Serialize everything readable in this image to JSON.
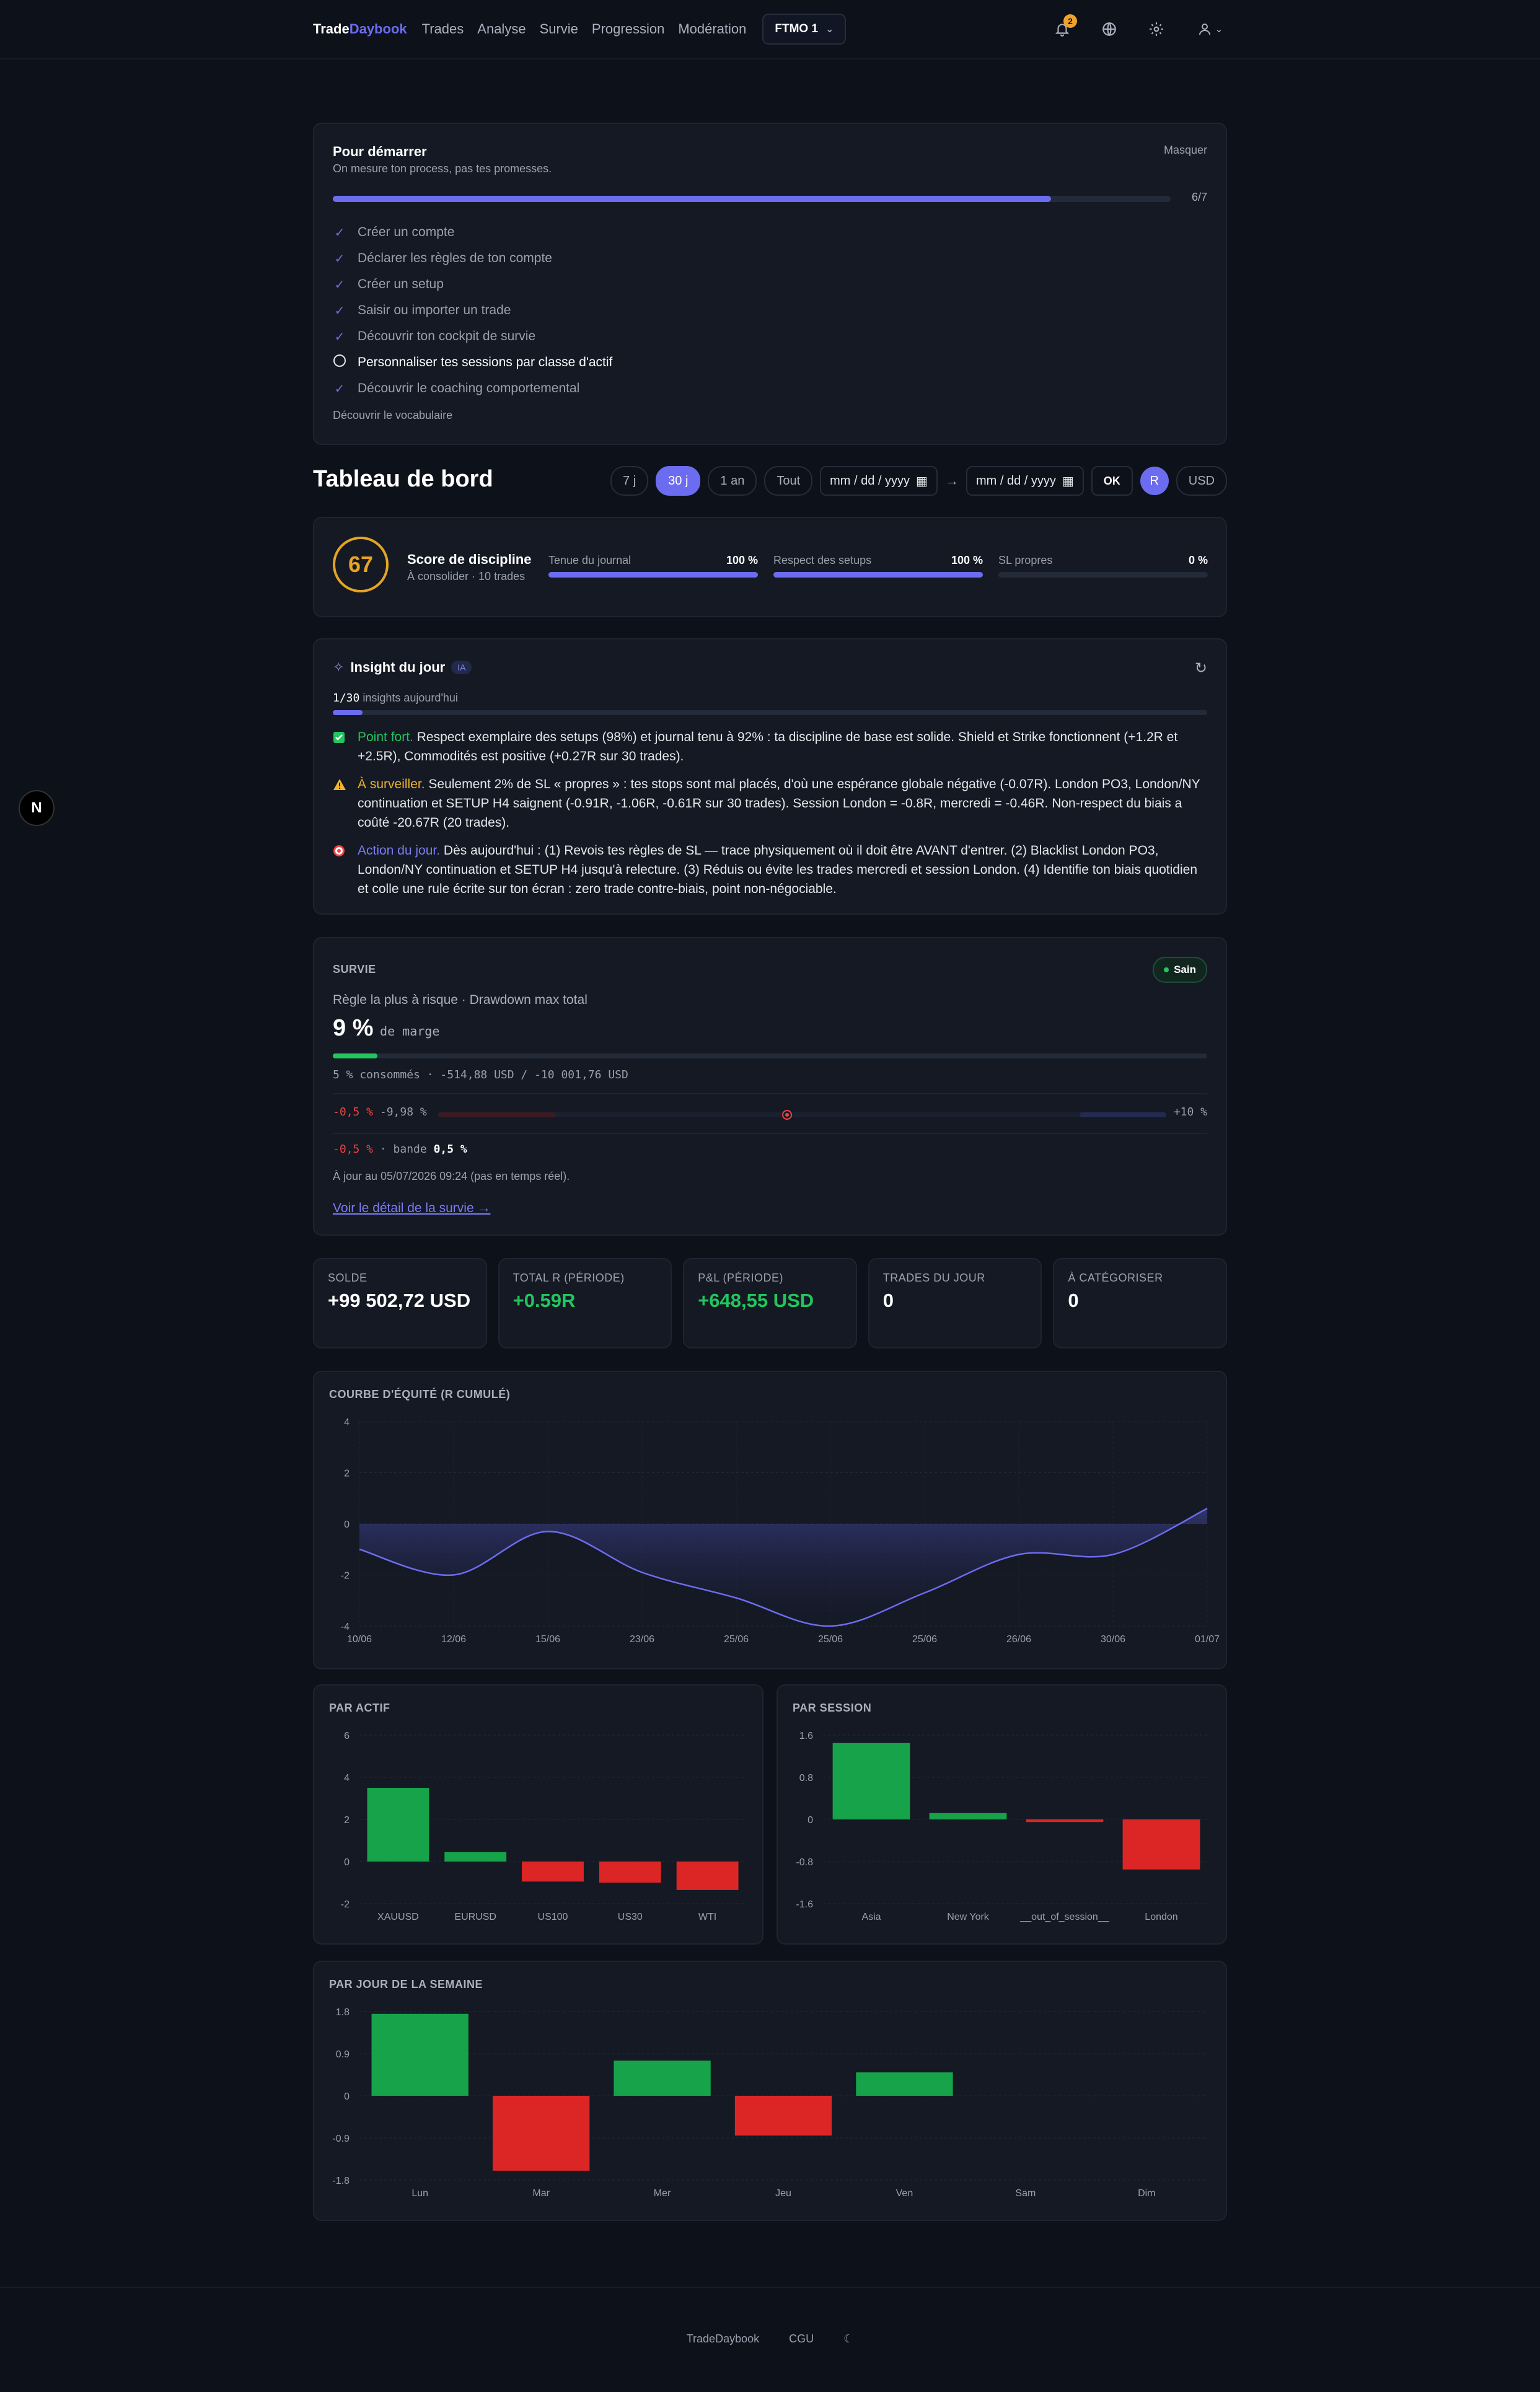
{
  "nav": {
    "brand_a": "Trade",
    "brand_b": "Daybook",
    "links": [
      "Trades",
      "Analyse",
      "Survie",
      "Progression",
      "Modération"
    ],
    "account": "FTMO 1",
    "notif_count": "2"
  },
  "onboarding": {
    "title": "Pour démarrer",
    "subtitle": "On mesure ton process, pas tes promesses.",
    "hide": "Masquer",
    "progress_text": "6/7",
    "progress": 0.857,
    "items": [
      {
        "label": "Créer un compte",
        "done": true
      },
      {
        "label": "Déclarer les règles de ton compte",
        "done": true
      },
      {
        "label": "Créer un setup",
        "done": true
      },
      {
        "label": "Saisir ou importer un trade",
        "done": true
      },
      {
        "label": "Découvrir ton cockpit de survie",
        "done": true
      },
      {
        "label": "Personnaliser tes sessions par classe d'actif",
        "done": false
      },
      {
        "label": "Découvrir le coaching comportemental",
        "done": true
      }
    ],
    "vocab_link": "Découvrir le vocabulaire"
  },
  "dashboard": {
    "title": "Tableau de bord",
    "periods": [
      "7 j",
      "30 j",
      "1 an",
      "Tout"
    ],
    "active_period": "30 j",
    "date_placeholder": "mm / dd / yyyy",
    "arrow": "→",
    "ok": "OK",
    "unit_r": "R",
    "unit_usd": "USD"
  },
  "discipline": {
    "score": "67",
    "title": "Score de discipline",
    "subtitle": "À consolider · 10 trades",
    "metrics": [
      {
        "label": "Tenue du journal",
        "value": "100 %",
        "fraction": 1.0
      },
      {
        "label": "Respect des setups",
        "value": "100 %",
        "fraction": 1.0
      },
      {
        "label": "SL propres",
        "value": "0 %",
        "fraction": 0.0
      }
    ]
  },
  "insight": {
    "title": "Insight du jour",
    "tag": "IA",
    "count_strong": "1/30",
    "count_text": " insights aujourd'hui",
    "items": [
      {
        "kind": "Point fort.",
        "text": " Respect exemplaire des setups (98%) et journal tenu à 92% : ta discipline de base est solide. Shield et Strike fonctionnent (+1.2R et +2.5R), Commodités est positive (+0.27R sur 30 trades)."
      },
      {
        "kind": "À surveiller.",
        "text": " Seulement 2% de SL « propres » : tes stops sont mal placés, d'où une espérance globale négative (-0.07R). London PO3, London/NY continuation et SETUP H4 saignent (-0.91R, -1.06R, -0.61R sur 30 trades). Session London = -0.8R, mercredi = -0.46R. Non-respect du biais a coûté -20.67R (20 trades)."
      },
      {
        "kind": "Action du jour.",
        "text": " Dès aujourd'hui : (1) Revois tes règles de SL — trace physiquement où il doit être AVANT d'entrer. (2) Blacklist London PO3, London/NY continuation et SETUP H4 jusqu'à relecture. (3) Réduis ou évite les trades mercredi et session London. (4) Identifie ton biais quotidien et colle une rule écrite sur ton écran : zero trade contre-biais, point non-négociable."
      }
    ]
  },
  "survie": {
    "label": "SURVIE",
    "status": "Sain",
    "rule": "Règle la plus à risque · Drawdown max total",
    "margin_value": "9 %",
    "margin_unit": "de marge",
    "consumed_fraction": 0.05,
    "consumed": "5 % consommés · -514,88 USD / -10 001,76 USD",
    "dd_left_neg": "-0,5 %",
    "dd_left_limit": "-9,98 %",
    "dd_right": "+10 %",
    "band_neg": "-0,5 %",
    "band_label": "· bande",
    "band_value": "0,5 %",
    "updated": "À jour au 05/07/2026 09:24 (pas en temps réel).",
    "link": "Voir le détail de la survie →"
  },
  "kpis": [
    {
      "label": "SOLDE",
      "value": "+99 502,72 USD",
      "positive": false
    },
    {
      "label": "TOTAL R (PÉRIODE)",
      "value": "+0.59R",
      "positive": true
    },
    {
      "label": "P&L (PÉRIODE)",
      "value": "+648,55 USD",
      "positive": true
    },
    {
      "label": "TRADES DU JOUR",
      "value": "0",
      "positive": false
    },
    {
      "label": "À CATÉGORISER",
      "value": "0",
      "positive": false
    }
  ],
  "colors": {
    "accent": "#6c6cf0",
    "positive": "#16a34a",
    "negative": "#dc2626",
    "warning": "#e5a423"
  },
  "chart_data": [
    {
      "type": "area",
      "title": "COURBE D'ÉQUITÉ (R CUMULÉ)",
      "x": [
        "10/06",
        "12/06",
        "15/06",
        "23/06",
        "25/06",
        "25/06",
        "25/06",
        "26/06",
        "30/06",
        "01/07"
      ],
      "y": [
        -1.0,
        -2.0,
        -0.3,
        -1.9,
        -2.9,
        -4.0,
        -2.7,
        -1.2,
        -1.2,
        0.6
      ],
      "yticks": [
        4,
        2,
        0,
        -2,
        -4
      ],
      "ylim": [
        -4,
        4
      ],
      "grid": true
    },
    {
      "type": "bar",
      "title": "PAR ACTIF",
      "categories": [
        "XAUUSD",
        "EURUSD",
        "US100",
        "US30",
        "WTI"
      ],
      "values": [
        3.5,
        0.45,
        -0.95,
        -1.0,
        -1.35
      ],
      "yticks": [
        6,
        4,
        2,
        0,
        -2
      ],
      "ylim": [
        -2,
        6
      ]
    },
    {
      "type": "bar",
      "title": "PAR SESSION",
      "categories": [
        "Asia",
        "New York",
        "__out_of_session__",
        "London"
      ],
      "values": [
        1.45,
        0.12,
        -0.05,
        -0.95
      ],
      "yticks": [
        "1.6",
        "0.8",
        "0",
        "-0.8",
        "-1.6"
      ],
      "ylim": [
        -1.6,
        1.6
      ]
    },
    {
      "type": "bar",
      "title": "PAR JOUR DE LA SEMAINE",
      "categories": [
        "Lun",
        "Mar",
        "Mer",
        "Jeu",
        "Ven",
        "Sam",
        "Dim"
      ],
      "values": [
        1.75,
        -1.6,
        0.75,
        -0.85,
        0.5,
        0,
        0
      ],
      "yticks": [
        "1.8",
        "0.9",
        "0",
        "-0.9",
        "-1.8"
      ],
      "ylim": [
        -1.8,
        1.8
      ]
    }
  ],
  "footer": {
    "brand": "TradeDaybook",
    "cgu": "CGU"
  }
}
